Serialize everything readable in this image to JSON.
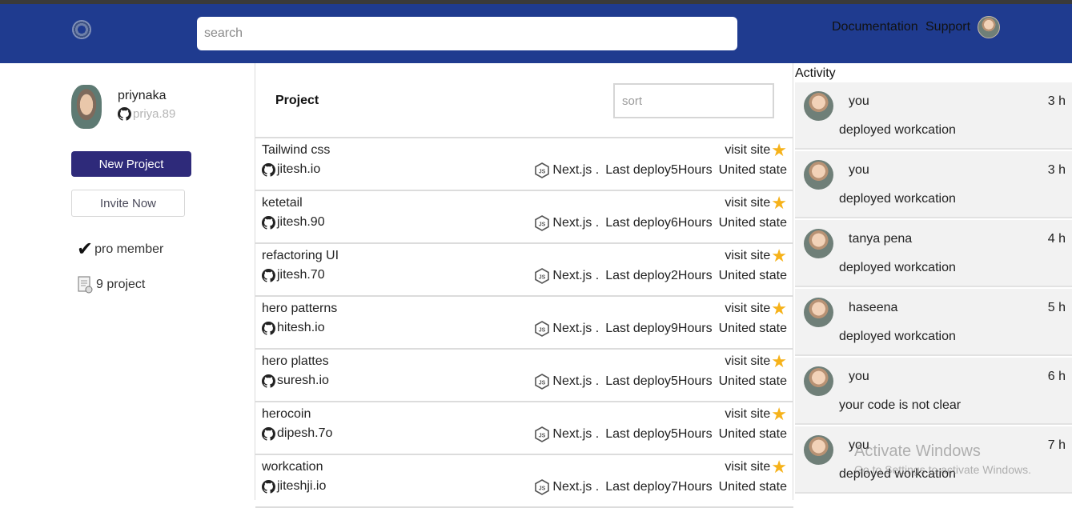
{
  "header": {
    "search_placeholder": "search",
    "nav": [
      "Documentation",
      "Support"
    ]
  },
  "profile": {
    "name": "priynaka",
    "handle": "priya.89",
    "new_project_label": "New Project",
    "invite_label": "Invite Now",
    "features": [
      {
        "icon": "checkmark-icon",
        "label": "pro member"
      },
      {
        "icon": "document-icon",
        "label": "9 project"
      }
    ]
  },
  "projects": {
    "title": "Project",
    "sort_placeholder": "sort",
    "visit_label": "visit site",
    "rows": [
      {
        "name": "Tailwind css",
        "handle": "jitesh.io",
        "framework": "Next.js .",
        "deploy": "Last deploy5Hours",
        "region": "United state"
      },
      {
        "name": "ketetail",
        "handle": "jitesh.90",
        "framework": "Next.js .",
        "deploy": "Last deploy6Hours",
        "region": "United state"
      },
      {
        "name": "refactoring UI",
        "handle": "jitesh.70",
        "framework": "Next.js .",
        "deploy": "Last deploy2Hours",
        "region": "United state"
      },
      {
        "name": "hero patterns",
        "handle": "hitesh.io",
        "framework": "Next.js .",
        "deploy": "Last deploy9Hours",
        "region": "United state"
      },
      {
        "name": "hero plattes",
        "handle": "suresh.io",
        "framework": "Next.js .",
        "deploy": "Last deploy5Hours",
        "region": "United state"
      },
      {
        "name": "herocoin",
        "handle": "dipesh.7o",
        "framework": "Next.js .",
        "deploy": "Last deploy5Hours",
        "region": "United state"
      },
      {
        "name": "workcation",
        "handle": "jiteshji.io",
        "framework": "Next.js .",
        "deploy": "Last deploy7Hours",
        "region": "United state"
      }
    ]
  },
  "activity": {
    "title": "Activity",
    "items": [
      {
        "user": "you",
        "time": "3 h",
        "message": "deployed workcation"
      },
      {
        "user": "you",
        "time": "3 h",
        "message": "deployed workcation"
      },
      {
        "user": "tanya pena",
        "time": "4 h",
        "message": "deployed workcation"
      },
      {
        "user": "haseena",
        "time": "5 h",
        "message": "deployed workcation"
      },
      {
        "user": "you",
        "time": "6 h",
        "message": "your code is not clear"
      },
      {
        "user": "you",
        "time": "7 h",
        "message": "deployed workcation"
      }
    ]
  },
  "watermark": {
    "line1": "Activate Windows",
    "line2": "Go to Settings to activate Windows."
  },
  "colors": {
    "header_bg": "#1f3b8f",
    "primary_button": "#2e2a7a",
    "star": "#f6b21a",
    "activity_bg": "#f2f2f2"
  }
}
